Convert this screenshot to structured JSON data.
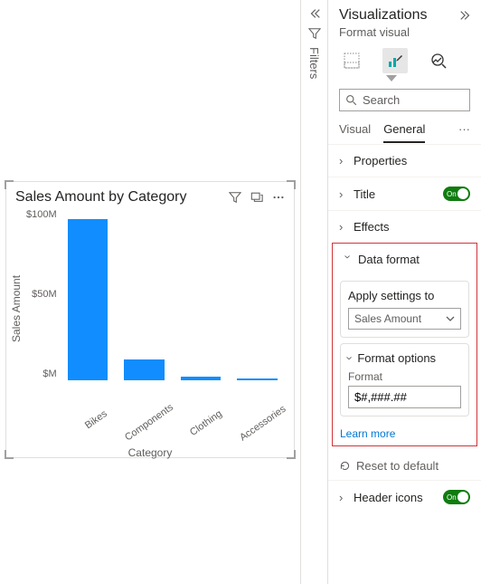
{
  "chart_data": {
    "type": "bar",
    "title": "Sales Amount by Category",
    "xlabel": "Category",
    "ylabel": "Sales Amount",
    "ylim": [
      0,
      100
    ],
    "y_ticks": [
      "$100M",
      "$50M",
      "$M"
    ],
    "categories": [
      "Bikes",
      "Components",
      "Clothing",
      "Accessories"
    ],
    "values": [
      94,
      12,
      2,
      1
    ]
  },
  "filters": {
    "label": "Filters"
  },
  "panel": {
    "title": "Visualizations",
    "subtitle": "Format visual",
    "search_placeholder": "Search",
    "tabs": {
      "visual": "Visual",
      "general": "General"
    },
    "sections": {
      "properties": "Properties",
      "title": "Title",
      "effects": "Effects",
      "data_format": "Data format",
      "header_icons": "Header icons"
    },
    "toggle_on": "On",
    "apply_label": "Apply settings to",
    "apply_value": "Sales Amount",
    "format_options": "Format options",
    "format_label": "Format",
    "format_value": "$#,###.##",
    "learn_more": "Learn more",
    "reset": "Reset to default"
  }
}
